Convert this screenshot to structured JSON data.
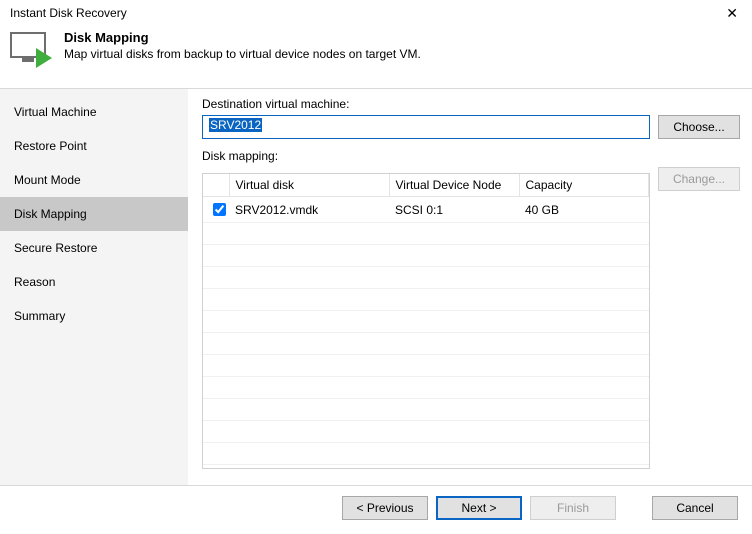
{
  "window": {
    "title": "Instant Disk Recovery",
    "close_glyph": "✕"
  },
  "header": {
    "title": "Disk Mapping",
    "subtitle": "Map virtual disks from backup to virtual device nodes on target VM."
  },
  "sidebar": {
    "items": [
      {
        "label": "Virtual Machine"
      },
      {
        "label": "Restore Point"
      },
      {
        "label": "Mount Mode"
      },
      {
        "label": "Disk Mapping",
        "active": true
      },
      {
        "label": "Secure Restore"
      },
      {
        "label": "Reason"
      },
      {
        "label": "Summary"
      }
    ]
  },
  "content": {
    "destination_label": "Destination virtual machine:",
    "destination_value": "SRV2012",
    "choose_label": "Choose...",
    "mapping_label": "Disk mapping:",
    "change_label": "Change...",
    "columns": {
      "col_check": "",
      "col_disk": "Virtual disk",
      "col_node": "Virtual Device Node",
      "col_cap": "Capacity"
    },
    "rows": [
      {
        "checked": true,
        "disk": "SRV2012.vmdk",
        "node": "SCSI 0:1",
        "capacity": "40 GB"
      }
    ]
  },
  "footer": {
    "previous": "< Previous",
    "next": "Next >",
    "finish": "Finish",
    "cancel": "Cancel"
  }
}
